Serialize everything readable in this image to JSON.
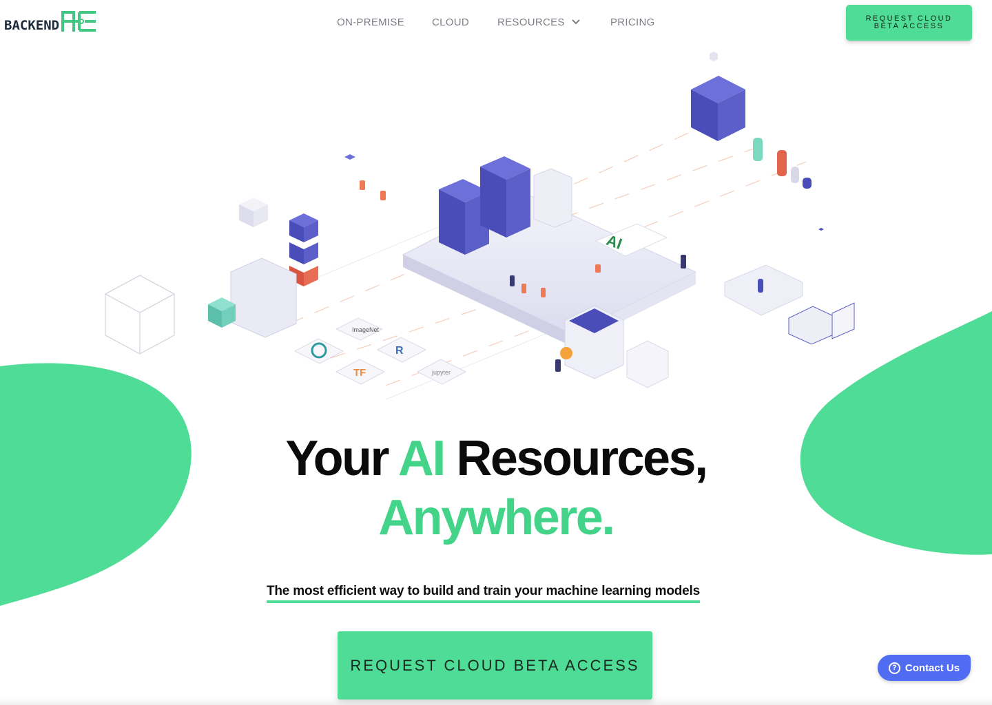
{
  "brand": {
    "wordmark": "BACKEND",
    "mark": "AI",
    "colors": {
      "accent": "#4fdc96",
      "accent_text": "#43d48a",
      "server": "#5b5fc7",
      "contact": "#4f6cf2"
    }
  },
  "nav": {
    "items": [
      {
        "label": "ON-PREMISE"
      },
      {
        "label": "CLOUD"
      },
      {
        "label": "RESOURCES",
        "icon": "chevron-down-icon"
      },
      {
        "label": "PRICING"
      }
    ]
  },
  "header": {
    "cta_label": "REQUEST CLOUD BETA ACCESS"
  },
  "hero": {
    "illustration_labels": [
      "ImageNet",
      "R",
      "jupyter",
      "TF"
    ],
    "headline_part1": "Your ",
    "headline_accent": "AI",
    "headline_part2": " Resources,",
    "headline_line2": "Anywhere.",
    "tagline": "The most efficient way to build and train your machine learning models",
    "cta_label": "REQUEST CLOUD BETA ACCESS"
  },
  "contact_widget": {
    "label": "Contact Us",
    "icon": "question-icon"
  }
}
